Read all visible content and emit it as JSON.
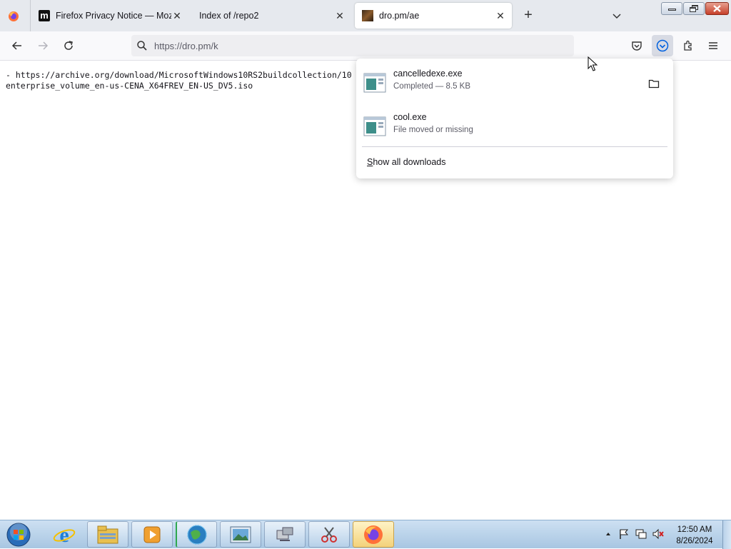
{
  "browser": {
    "tabs": [
      {
        "title": "Firefox Privacy Notice — Mozill",
        "favicon": "mozilla-m-icon",
        "active": false
      },
      {
        "title": "Index of /repo2",
        "favicon": "none",
        "active": false
      },
      {
        "title": "dro.pm/ae",
        "favicon": "image-thumbnail-icon",
        "active": true
      }
    ],
    "new_tab_label": "+",
    "close_glyph": "✕",
    "url": "https://dro.pm/k"
  },
  "page": {
    "lines": [
      "- https://archive.org/download/MicrosoftWindows10RS2buildcollection/10",
      "enterprise_volume_en-us-CENA_X64FREV_EN-US_DV5.iso"
    ]
  },
  "downloads_panel": {
    "items": [
      {
        "name": "cancelledexe.exe",
        "status": "Completed — 8.5 KB",
        "has_folder_button": true
      },
      {
        "name": "cool.exe",
        "status": "File moved or missing",
        "has_folder_button": false
      }
    ],
    "show_all_label": "Show all downloads"
  },
  "taskbar": {
    "time": "12:50 AM",
    "date": "8/26/2024",
    "buttons": [
      "internet-explorer-icon",
      "file-explorer-icon",
      "media-player-icon",
      "globe-app-icon",
      "picture-viewer-icon",
      "network-app-icon",
      "snipping-tool-icon",
      "firefox-icon"
    ],
    "active_button": "firefox-icon"
  },
  "colors": {
    "accent": "#0061e0",
    "taskbar": "#b9d2ea",
    "tab_strip": "#e6e9ee"
  }
}
